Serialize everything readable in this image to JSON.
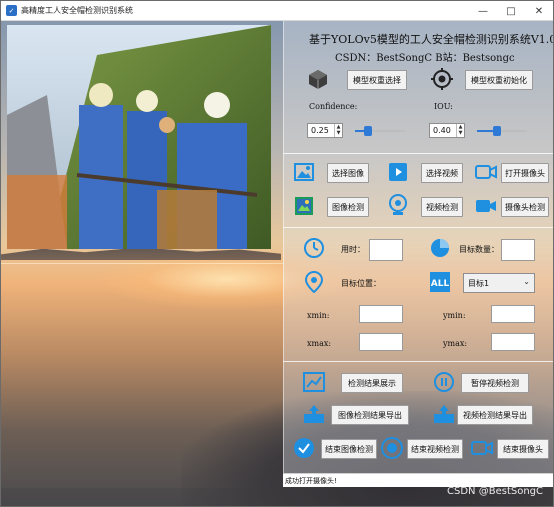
{
  "window": {
    "title": "高精度工人安全帽检测识别系统",
    "controls": [
      "minimize-icon",
      "maximize-icon",
      "close-icon"
    ]
  },
  "header": {
    "title": "基于YOLOv5模型的工人安全帽检测识别系统V1.0",
    "credits": "CSDN：BestSongC   B站：Bestsongc"
  },
  "model": {
    "select_button": "模型权重选择",
    "init_button": "模型权重初始化",
    "select_icon": "cube-icon",
    "init_icon": "target-gear-icon"
  },
  "params": {
    "confidence_label": "Confidence:",
    "confidence_value": "0.25",
    "confidence_level": 0.25,
    "iou_label": "IOU:",
    "iou_value": "0.40",
    "iou_level": 0.4
  },
  "source_buttons": {
    "select_image": "选择图像",
    "select_video": "选择视频",
    "open_camera": "打开摄像头",
    "image_detect": "图像检测",
    "video_detect": "视频检测",
    "camera_detect": "摄像头检测"
  },
  "results": {
    "time_label": "用时：",
    "time_value": "",
    "count_label": "目标数量：",
    "count_value": "",
    "position_label": "目标位置：",
    "target_select": "目标1",
    "xmin_label": "xmin:",
    "ymin_label": "ymin:",
    "xmax_label": "xmax:",
    "ymax_label": "ymax:"
  },
  "actions": {
    "show_result": "检测结果展示",
    "pause_video": "暂停视频检测",
    "export_image_result": "图像检测结果导出",
    "export_video_result": "视频检测结果导出",
    "end_image_detect": "结束图像检测",
    "end_video_detect": "结束视频检测",
    "end_camera": "结束摄像头"
  },
  "status": {
    "message": "成功打开摄像头!"
  },
  "watermark": "CSDN @BestSongC",
  "colors": {
    "accent_blue": "#2f79d6",
    "icon_blue": "#1f8fe0",
    "button_bg": "#f2f2f2"
  }
}
